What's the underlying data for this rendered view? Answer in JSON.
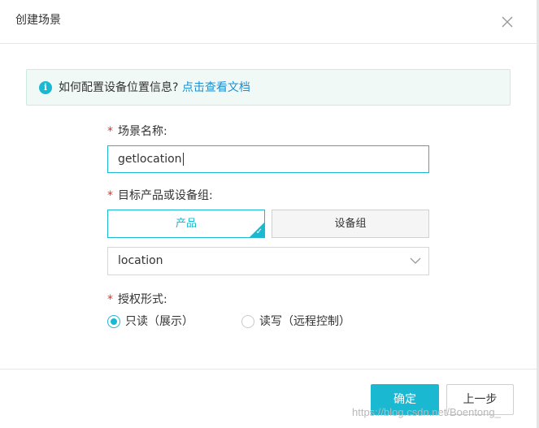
{
  "dialog": {
    "title": "创建场景",
    "close_icon": "close-icon"
  },
  "notice": {
    "icon": "info-icon",
    "text": "如何配置设备位置信息?",
    "link": "点击查看文档"
  },
  "form": {
    "scene_name": {
      "required_mark": "*",
      "label": "场景名称:",
      "value": "getlocation"
    },
    "target": {
      "required_mark": "*",
      "label": "目标产品或设备组:",
      "options": [
        "产品",
        "设备组"
      ],
      "selected": "产品",
      "select_value": "location"
    },
    "permission": {
      "required_mark": "*",
      "label": "授权形式:",
      "options": [
        "只读（展示）",
        "读写（远程控制）"
      ],
      "selected": "只读（展示）"
    }
  },
  "footer": {
    "confirm_label": "确定",
    "back_label": "上一步"
  },
  "watermark": "https://blog.csdn.net/Boentong_",
  "colors": {
    "accent": "#1bb8d2",
    "link": "#1d8fd0",
    "required": "#e0312f",
    "notice_bg": "#f0f9f6"
  }
}
